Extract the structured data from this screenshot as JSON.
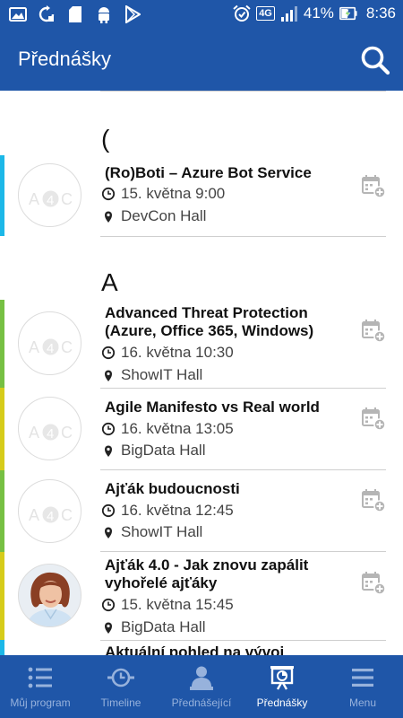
{
  "status_bar": {
    "network": "4G",
    "battery": "41%",
    "time": "8:36"
  },
  "app_bar": {
    "title": "Přednášky"
  },
  "sections": [
    {
      "letter": "(",
      "items": [
        {
          "title": "(Ro)Boti – Azure Bot Service",
          "time": "15. května 9:00",
          "place": "DevCon Hall",
          "accent": "#1cb8e8",
          "avatar": "a4c"
        }
      ]
    },
    {
      "letter": "A",
      "items": [
        {
          "title": "Advanced Threat Protection (Azure, Office 365, Windows)",
          "time": "16. května 10:30",
          "place": "ShowIT Hall",
          "accent": "#76c043",
          "avatar": "a4c"
        },
        {
          "title": "Agile Manifesto vs Real world",
          "time": "16. května 13:05",
          "place": "BigData Hall",
          "accent": "#d6cc1a",
          "avatar": "a4c"
        },
        {
          "title": "Ajťák budoucnosti",
          "time": "16. května 12:45",
          "place": "ShowIT Hall",
          "accent": "#76c043",
          "avatar": "a4c"
        },
        {
          "title": "Ajťák 4.0 - Jak znovu zapálit vyhořelé ajťáky",
          "time": "15. května 15:45",
          "place": "BigData Hall",
          "accent": "#d6cc1a",
          "avatar": "photo"
        },
        {
          "title": "Aktuální pohled na vývoj",
          "accent": "#1cb8e8"
        }
      ]
    }
  ],
  "bottom_nav": [
    {
      "label": "Můj program",
      "icon": "list-icon",
      "active": false
    },
    {
      "label": "Timeline",
      "icon": "timeline-icon",
      "active": false
    },
    {
      "label": "Přednášející",
      "icon": "speaker-icon",
      "active": false
    },
    {
      "label": "Přednášky",
      "icon": "presentation-icon",
      "active": true
    },
    {
      "label": "Menu",
      "icon": "menu-icon",
      "active": false
    }
  ]
}
